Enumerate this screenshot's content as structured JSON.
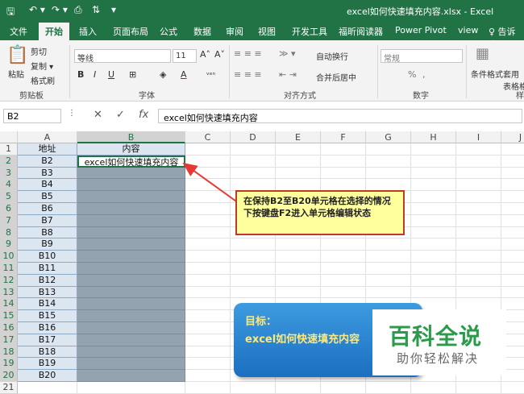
{
  "title_bar": {
    "title": "excel如何快速填充内容.xlsx - Excel",
    "icons": [
      "save-icon",
      "undo-icon",
      "redo-icon",
      "print-preview-icon",
      "sort-icon",
      "customize-icon"
    ]
  },
  "tabs": [
    "文件",
    "开始",
    "插入",
    "页面布局",
    "公式",
    "数据",
    "审阅",
    "视图",
    "开发工具",
    "福昕阅读器",
    "Power Pivot",
    "view",
    "♀ 告诉我"
  ],
  "active_tab": "开始",
  "ribbon": {
    "clipboard": {
      "paste": "粘贴",
      "cut": "剪切",
      "copy": "复制 ▾",
      "format_painter": "格式刷",
      "label": "剪贴板"
    },
    "font": {
      "name": "等线",
      "size": "11",
      "grow": "A˄",
      "shrink": "A˅",
      "bold": "B",
      "italic": "I",
      "underline": "U",
      "border": "⊞",
      "fill": "◈",
      "color": "A",
      "phonetic": "ᵥₑₙ",
      "label": "字体"
    },
    "alignment": {
      "wrap": "自动换行",
      "merge": "合并后居中",
      "label": "对齐方式"
    },
    "number": {
      "format": "常规",
      "percent": "%",
      "comma": ",",
      "label": "数字"
    },
    "styles": {
      "conditional": "条件格式",
      "table": "套用\n表格格",
      "label": "样"
    }
  },
  "formula_bar": {
    "name_box": "B2",
    "cancel": "✕",
    "enter": "✓",
    "fx": "fx",
    "content": "excel如何快速填充内容"
  },
  "columns": [
    "A",
    "B",
    "C",
    "D",
    "E",
    "F",
    "G",
    "H",
    "I",
    "J"
  ],
  "rows": [
    "1",
    "2",
    "3",
    "4",
    "5",
    "6",
    "7",
    "8",
    "9",
    "10",
    "11",
    "12",
    "13",
    "14",
    "15",
    "16",
    "17",
    "18",
    "19",
    "20",
    "21"
  ],
  "colA": [
    "地址",
    "B2",
    "B3",
    "B4",
    "B5",
    "B6",
    "B7",
    "B8",
    "B9",
    "B10",
    "B11",
    "B12",
    "B13",
    "B14",
    "B15",
    "B16",
    "B17",
    "B18",
    "B19",
    "B20",
    ""
  ],
  "colB": [
    "内容",
    "excel如何快速填充内容",
    "",
    "",
    "",
    "",
    "",
    "",
    "",
    "",
    "",
    "",
    "",
    "",
    "",
    "",
    "",
    "",
    "",
    "",
    ""
  ],
  "callout": {
    "text": "在保持B2至B20单元格在选择的情况下按键盘F2进入单元格编辑状态"
  },
  "target": {
    "heading": "目标：",
    "text": "excel如何快速填充内容"
  },
  "watermark": {
    "brand": "百科全说",
    "slogan": "助你轻松解决"
  },
  "colors": {
    "accent": "#217346",
    "selection": "#94a3b0",
    "arrow": "#e53935"
  }
}
